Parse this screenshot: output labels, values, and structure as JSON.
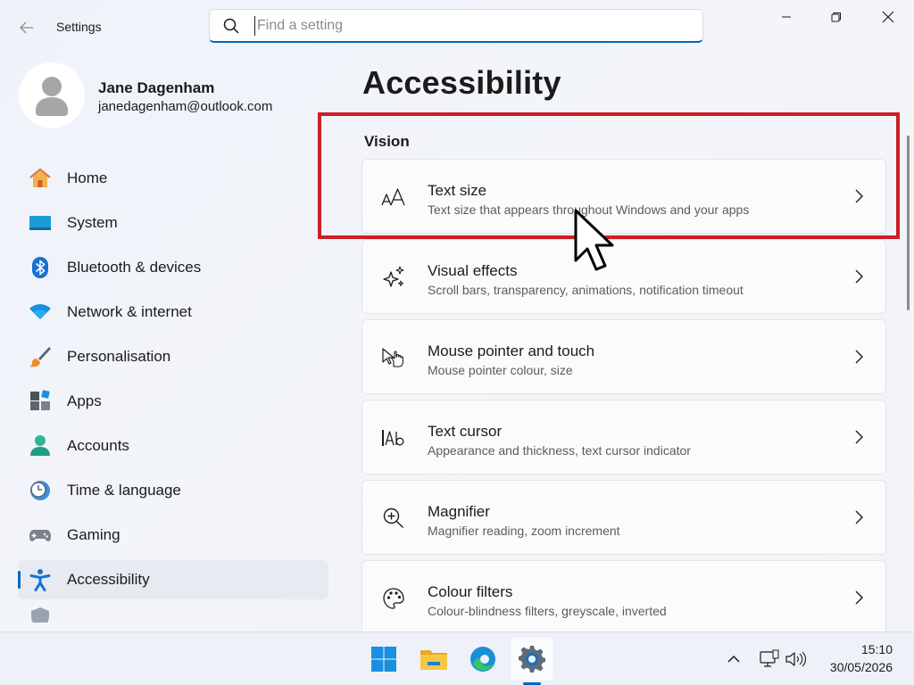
{
  "window": {
    "title": "Settings",
    "back_icon": "back-arrow-icon",
    "controls": [
      "minimize-icon",
      "restore-icon",
      "close-icon"
    ]
  },
  "search": {
    "placeholder": "Find a setting",
    "value": "",
    "icon": "search-icon"
  },
  "profile": {
    "name": "Jane Dagenham",
    "email": "janedagenham@outlook.com",
    "avatar_icon": "person-avatar-icon"
  },
  "sidebar": {
    "items": [
      {
        "label": "Home",
        "icon": "home-icon",
        "selected": false
      },
      {
        "label": "System",
        "icon": "system-icon",
        "selected": false
      },
      {
        "label": "Bluetooth & devices",
        "icon": "bluetooth-icon",
        "selected": false
      },
      {
        "label": "Network & internet",
        "icon": "wifi-icon",
        "selected": false
      },
      {
        "label": "Personalisation",
        "icon": "paintbrush-icon",
        "selected": false
      },
      {
        "label": "Apps",
        "icon": "apps-icon",
        "selected": false
      },
      {
        "label": "Accounts",
        "icon": "accounts-icon",
        "selected": false
      },
      {
        "label": "Time & language",
        "icon": "clock-globe-icon",
        "selected": false
      },
      {
        "label": "Gaming",
        "icon": "gamepad-icon",
        "selected": false
      },
      {
        "label": "Accessibility",
        "icon": "accessibility-icon",
        "selected": true
      }
    ]
  },
  "main": {
    "page_title": "Accessibility",
    "section_title": "Vision",
    "cards": [
      {
        "title": "Text size",
        "subtitle": "Text size that appears throughout Windows and your apps",
        "icon": "text-size-icon"
      },
      {
        "title": "Visual effects",
        "subtitle": "Scroll bars, transparency, animations, notification timeout",
        "icon": "sparkle-icon"
      },
      {
        "title": "Mouse pointer and touch",
        "subtitle": "Mouse pointer colour, size",
        "icon": "pointer-touch-icon"
      },
      {
        "title": "Text cursor",
        "subtitle": "Appearance and thickness, text cursor indicator",
        "icon": "text-cursor-icon"
      },
      {
        "title": "Magnifier",
        "subtitle": "Magnifier reading, zoom increment",
        "icon": "magnifier-icon"
      },
      {
        "title": "Colour filters",
        "subtitle": "Colour-blindness filters, greyscale, inverted",
        "icon": "palette-icon"
      }
    ]
  },
  "taskbar": {
    "apps": [
      {
        "name": "Start",
        "icon": "windows-start-icon",
        "active": false
      },
      {
        "name": "File Explorer",
        "icon": "folder-icon",
        "active": false
      },
      {
        "name": "Microsoft Edge",
        "icon": "edge-icon",
        "active": false
      },
      {
        "name": "Settings",
        "icon": "settings-gear-icon",
        "active": true
      }
    ],
    "tray_icons": [
      "chevron-up-icon",
      "network-monitor-icon",
      "volume-icon"
    ],
    "time": "15:10",
    "date": "30/05/2026"
  },
  "colors": {
    "accent": "#0067c0",
    "highlight_border": "#cc1f24",
    "background": "#f1f3f8"
  }
}
